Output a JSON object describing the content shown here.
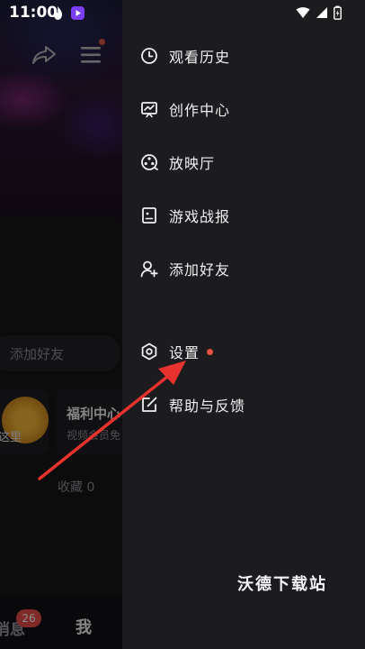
{
  "status_bar": {
    "time": "11:00",
    "app_icons": [
      "flame-icon",
      "video-icon"
    ],
    "system_icons": [
      "wifi-icon",
      "signal-icon",
      "battery-icon"
    ]
  },
  "background_page": {
    "add_friend_label": "添加好友",
    "tile_left_text": "这里",
    "tile_right_title": "福利中心",
    "tile_right_subtitle": "视频会员免",
    "collect_label": "收藏 0",
    "tabs": {
      "messages": "消息",
      "messages_badge": "26",
      "me": "我"
    }
  },
  "drawer": {
    "items": [
      {
        "label": "观看历史",
        "icon": "clock-icon"
      },
      {
        "label": "创作中心",
        "icon": "creator-chart-icon"
      },
      {
        "label": "放映厅",
        "icon": "film-reel-icon"
      },
      {
        "label": "游戏战报",
        "icon": "game-report-icon"
      },
      {
        "label": "添加好友",
        "icon": "add-person-icon"
      },
      {
        "label": "设置",
        "icon": "hexagon-settings-icon",
        "has_dot": true
      },
      {
        "label": "帮助与反馈",
        "icon": "edit-feedback-icon"
      }
    ],
    "watermark": "沃德下载站"
  },
  "colors": {
    "drawer_bg": "#1c1c1e",
    "notification_dot": "#e8533f",
    "annotation_arrow": "#e8322e"
  }
}
